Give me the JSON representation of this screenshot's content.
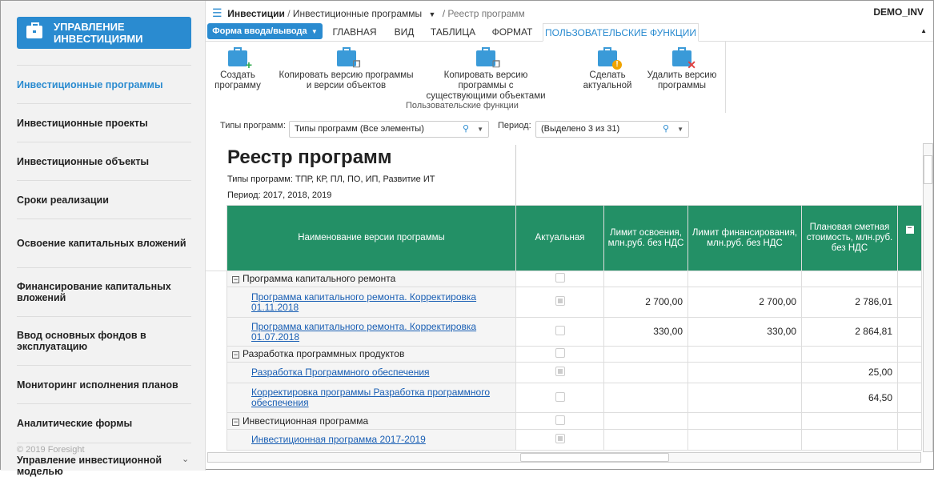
{
  "sidebar": {
    "logo": "УПРАВЛЕНИЕ ИНВЕСТИЦИЯМИ",
    "items": [
      {
        "label": "Инвестиционные программы",
        "active": true
      },
      {
        "label": "Инвестиционные проекты"
      },
      {
        "label": "Инвестиционные объекты"
      },
      {
        "label": "Сроки реализации"
      },
      {
        "label": "Освоение капитальных вложений"
      },
      {
        "label": "Финансирование капитальных вложений"
      },
      {
        "label": "Ввод основных фондов в эксплуатацию"
      },
      {
        "label": "Мониторинг исполнения планов"
      },
      {
        "label": "Аналитические формы"
      }
    ],
    "copyright": "© 2019 Foresight",
    "bottom_item": "Управление инвестиционной моделью"
  },
  "header": {
    "root": "Инвестиции",
    "section": "Инвестиционные программы",
    "page": "Реестр программ",
    "user": "DEMO_INV"
  },
  "tabs": {
    "form_button": "Форма ввода/вывода",
    "items": [
      "ГЛАВНАЯ",
      "ВИД",
      "ТАБЛИЦА",
      "ФОРМАТ",
      "ПОЛЬЗОВАТЕЛЬСКИЕ ФУНКЦИИ"
    ]
  },
  "ribbon": {
    "buttons": [
      "Создать программу",
      "Копировать версию программы и версии объектов",
      "Копировать версию программы с существующими объектами",
      "Сделать актуальной",
      "Удалить версию программы"
    ],
    "group": "Пользовательские функции"
  },
  "filters": {
    "types_label": "Типы программ:",
    "types_value": "Типы программ (Все элементы)",
    "period_label": "Период:",
    "period_value": "(Выделено 3 из 31)"
  },
  "report": {
    "title": "Реестр программ",
    "types": "Типы программ: ТПР, КР, ПЛ, ПО, ИП, Развитие ИТ",
    "period": "Период: 2017, 2018, 2019",
    "columns": [
      "Наименование версии программы",
      "Актуальная",
      "Лимит освоения, млн.руб. без НДС",
      "Лимит финансирования, млн.руб. без НДС",
      "Плановая сметная стоимость, млн.руб. без НДС"
    ],
    "rows": [
      {
        "type": "group",
        "name": "Программа капитального ремонта"
      },
      {
        "type": "item",
        "name": "Программа капитального ремонта. Корректировка 01.11.2018",
        "actual": true,
        "limit_dev": "2 700,00",
        "limit_fin": "2 700,00",
        "cost": "2 786,01"
      },
      {
        "type": "item",
        "name": "Программа капитального ремонта. Корректировка 01.07.2018",
        "actual": false,
        "limit_dev": "330,00",
        "limit_fin": "330,00",
        "cost": "2 864,81"
      },
      {
        "type": "group",
        "name": "Разработка программных продуктов"
      },
      {
        "type": "item",
        "name": "Разработка Программного обеспечения",
        "actual": true,
        "limit_dev": "",
        "limit_fin": "",
        "cost": "25,00"
      },
      {
        "type": "item",
        "name": "Корректировка программы Разработка программного обеспечения",
        "actual": false,
        "limit_dev": "",
        "limit_fin": "",
        "cost": "64,50"
      },
      {
        "type": "group",
        "name": "Инвестиционная программа"
      },
      {
        "type": "item",
        "name": "Инвестиционная программа 2017-2019",
        "actual": true,
        "limit_dev": "",
        "limit_fin": "",
        "cost": ""
      }
    ]
  }
}
